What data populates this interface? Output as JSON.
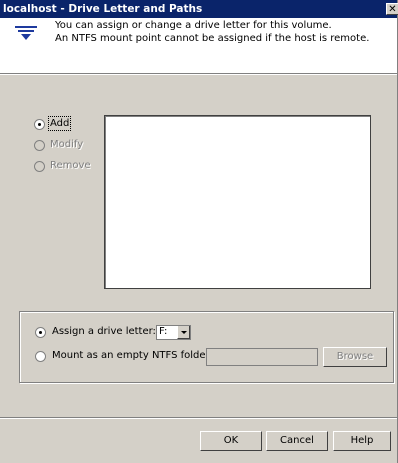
{
  "window": {
    "title": "localhost - Drive Letter and Paths",
    "close_glyph": "✕"
  },
  "header": {
    "icon": "veritas-logo-icon",
    "line1": "You can assign or change a drive letter for this volume.",
    "line2": "An NTFS mount point cannot be assigned if the host is remote."
  },
  "actions": {
    "add": {
      "label": "Add",
      "checked": true,
      "enabled": true
    },
    "modify": {
      "label": "Modify",
      "checked": false,
      "enabled": false
    },
    "remove": {
      "label": "Remove",
      "checked": false,
      "enabled": false
    }
  },
  "options": {
    "assign_label": "Assign a drive letter:",
    "drive_letter_value": "F:",
    "mount_label": "Mount as an empty NTFS folder:",
    "mount_path_value": "",
    "browse_label": "Browse"
  },
  "footer": {
    "ok_label": "OK",
    "cancel_label": "Cancel",
    "help_label": "Help"
  },
  "colors": {
    "titlebar": "#0a246a",
    "dialog_face": "#d4d0c8"
  }
}
